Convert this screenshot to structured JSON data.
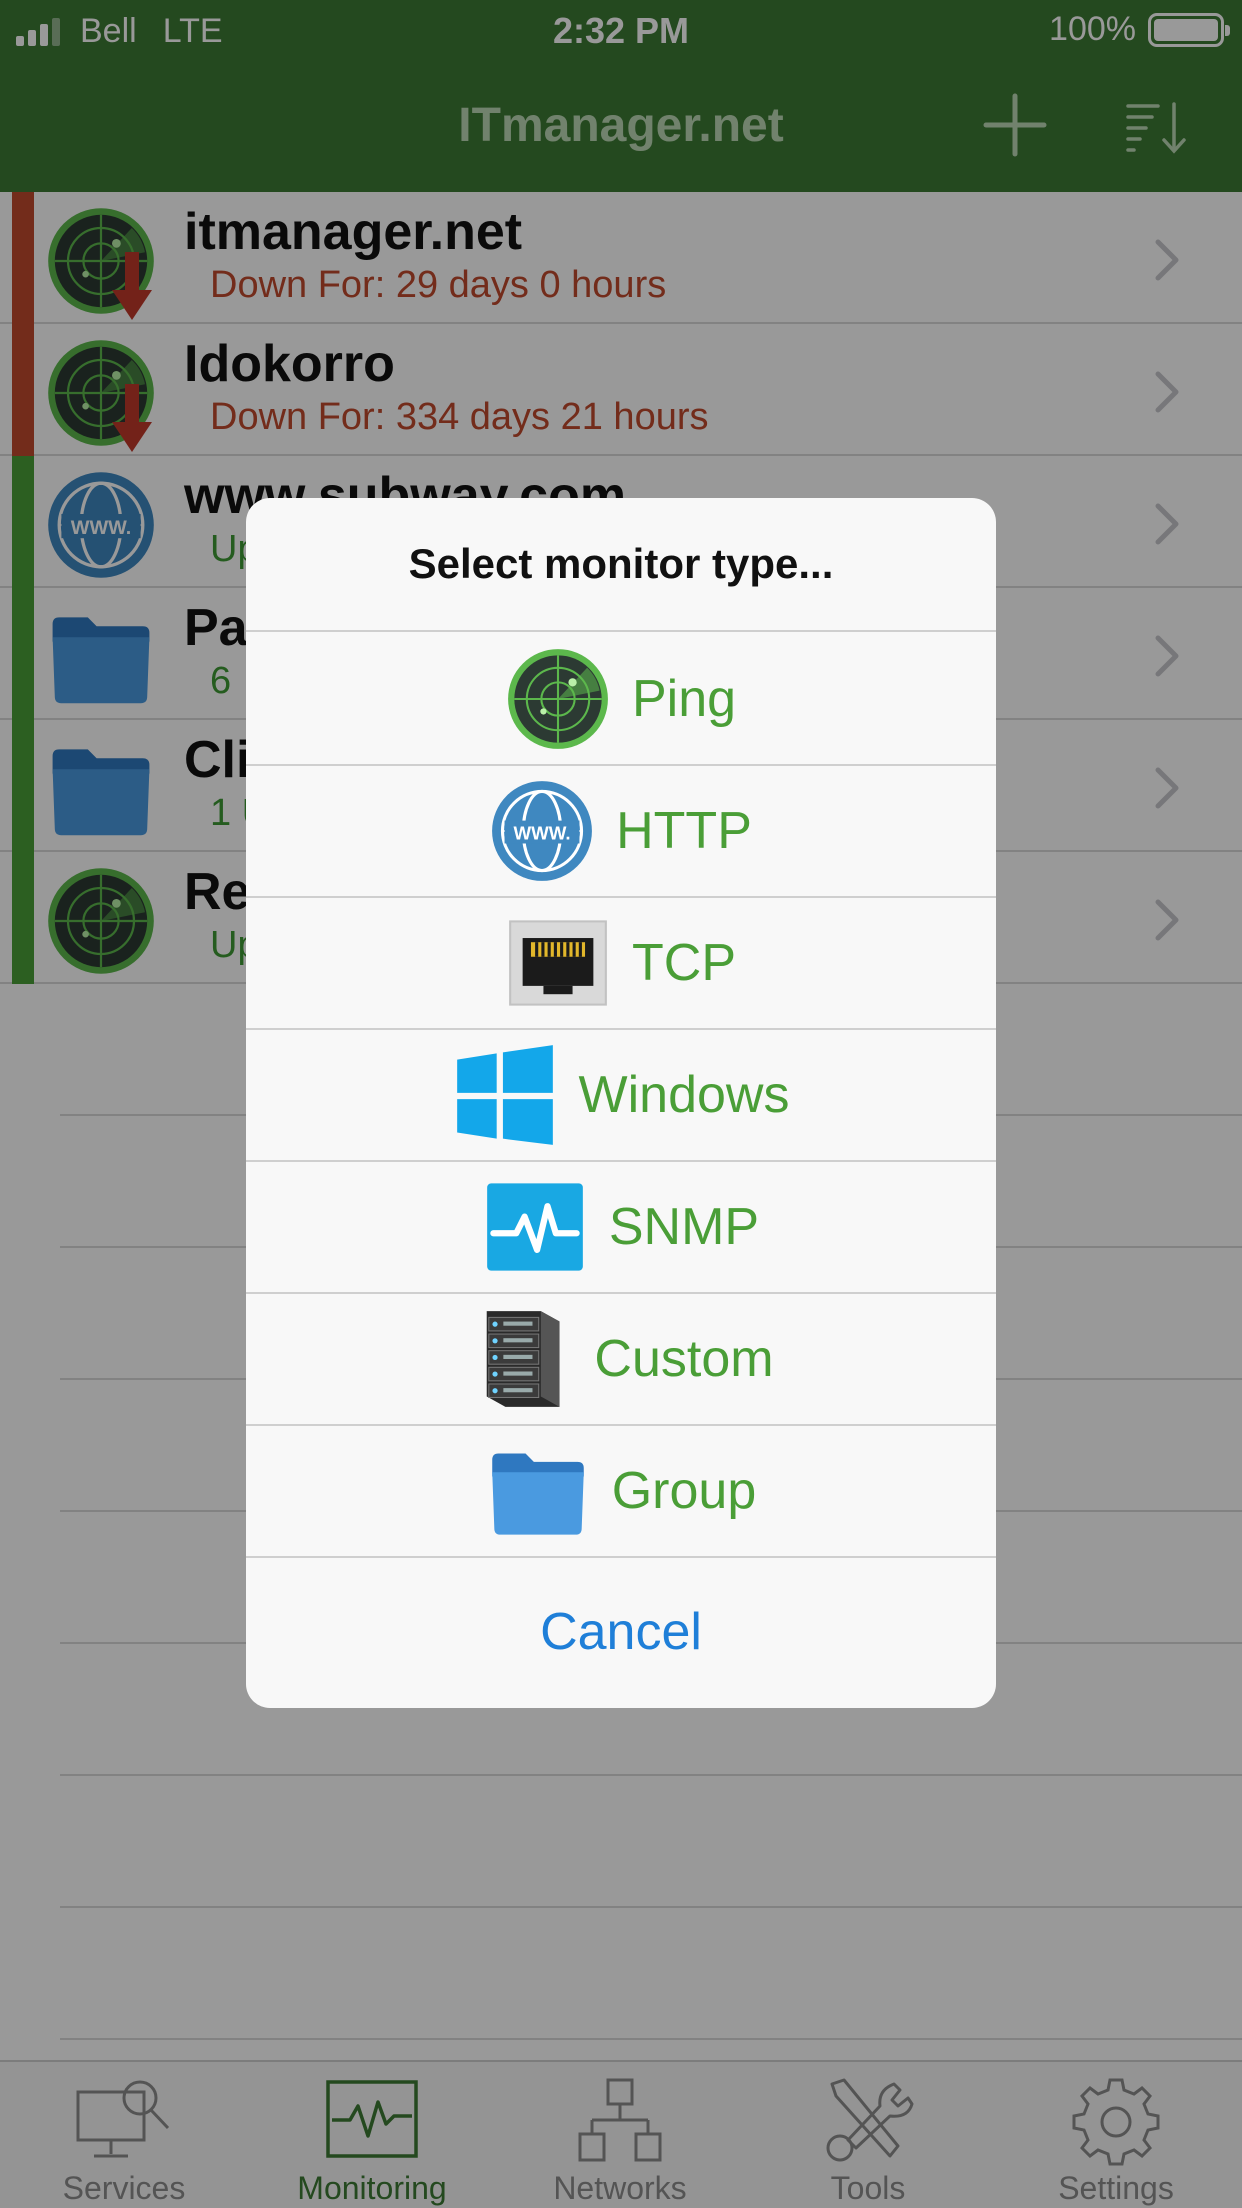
{
  "status_bar": {
    "carrier": "Bell",
    "network": "LTE",
    "time": "2:32 PM",
    "battery": "100%"
  },
  "nav": {
    "title": "ITmanager.net",
    "add_icon": "plus-icon",
    "sort_icon": "sort-icon"
  },
  "monitors": [
    {
      "name": "itmanager.net",
      "status_text": "Down For: 29 days 0 hours",
      "state": "down",
      "icon": "radar-icon"
    },
    {
      "name": "Idokorro",
      "status_text": "Down For: 334 days 21 hours",
      "state": "down",
      "icon": "radar-icon"
    },
    {
      "name": "www.subway.com",
      "status_text": "Up",
      "state": "up",
      "icon": "www-globe-icon"
    },
    {
      "name": "Pa",
      "status_text": "6",
      "state": "up",
      "icon": "folder-icon"
    },
    {
      "name": "Cli",
      "status_text": "1 U",
      "state": "up",
      "icon": "folder-icon"
    },
    {
      "name": "Re",
      "status_text": "Up",
      "state": "up",
      "icon": "radar-icon"
    }
  ],
  "dialog": {
    "title": "Select monitor type...",
    "options": [
      {
        "label": "Ping",
        "icon": "radar-icon"
      },
      {
        "label": "HTTP",
        "icon": "www-globe-icon"
      },
      {
        "label": "TCP",
        "icon": "ethernet-port-icon"
      },
      {
        "label": "Windows",
        "icon": "windows-logo-icon"
      },
      {
        "label": "SNMP",
        "icon": "pulse-monitor-icon"
      },
      {
        "label": "Custom",
        "icon": "server-rack-icon"
      },
      {
        "label": "Group",
        "icon": "folder-icon"
      }
    ],
    "cancel": "Cancel"
  },
  "tabs": [
    {
      "label": "Services",
      "icon": "monitor-search-icon",
      "active": false
    },
    {
      "label": "Monitoring",
      "icon": "activity-monitor-icon",
      "active": true
    },
    {
      "label": "Networks",
      "icon": "network-tree-icon",
      "active": false
    },
    {
      "label": "Tools",
      "icon": "tools-icon",
      "active": false
    },
    {
      "label": "Settings",
      "icon": "gear-icon",
      "active": false
    }
  ],
  "colors": {
    "brand_green": "#3d7a34",
    "down_red": "#c04a2d",
    "up_green": "#4a9e37",
    "link_blue": "#1f7fd8"
  }
}
